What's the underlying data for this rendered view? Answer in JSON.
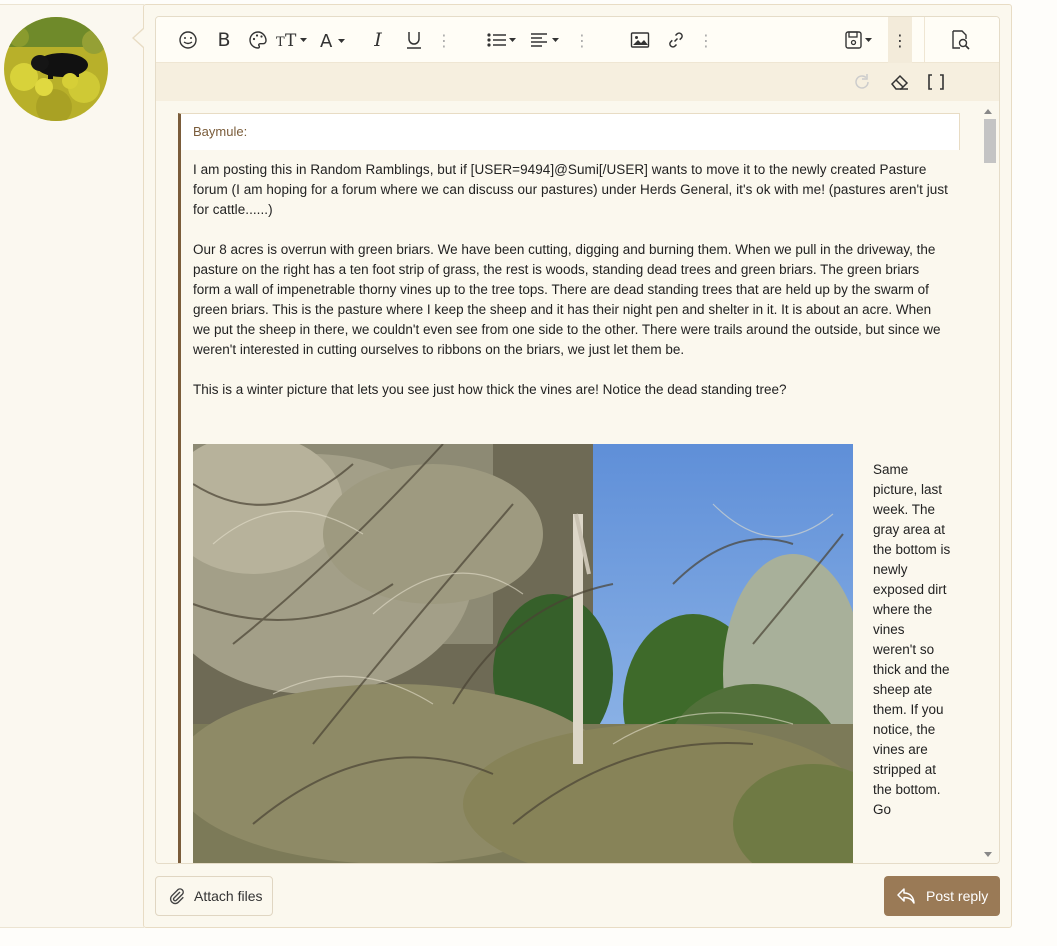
{
  "quote": {
    "author": "Baymule:",
    "paragraphs": [
      "I am posting this in Random Ramblings, but if [USER=9494]@Sumi[/USER] wants to move it to the newly created Pasture forum (I am hoping for a forum where we can discuss our pastures)  under Herds General, it's ok with me! (pastures aren't just for cattle......)",
      "Our 8 acres is overrun with green briars. We have been cutting, digging and burning them. When we pull in the driveway, the pasture on the right has a ten foot strip of grass, the rest is woods, standing dead trees and green briars. The green briars form a wall of impenetrable thorny vines up to the tree tops. There are dead standing trees that are held up by the swarm of green briars. This is the pasture where I keep the sheep and it has their night pen and shelter in it. It is about an acre. When we put the sheep in there, we couldn't even see from one side to the other. There were trails around the outside, but since we weren't interested in cutting ourselves to ribbons on the briars, we just let them be.",
      "This is a winter picture that lets you see just how thick the vines are! Notice the dead standing tree?"
    ],
    "side_caption": "Same picture, last week. The gray area at the bottom is newly exposed dirt where the vines weren't so thick and the sheep ate them. If you notice, the vines are stripped at the bottom. Go"
  },
  "actions": {
    "attach_label": "Attach files",
    "post_label": "Post reply"
  },
  "toolbar": {
    "icons": [
      "smile-icon",
      "bold-icon",
      "palette-icon",
      "text-size-icon",
      "font-family-icon",
      "italic-icon",
      "underline-icon",
      "list-icon",
      "align-icon",
      "image-icon",
      "link-icon",
      "save-draft-icon",
      "preview-icon",
      "redo-icon",
      "eraser-icon",
      "bbcode-toggle-icon"
    ]
  },
  "colors": {
    "accent": "#9a7a56",
    "quote_border": "#7a5c3a"
  }
}
